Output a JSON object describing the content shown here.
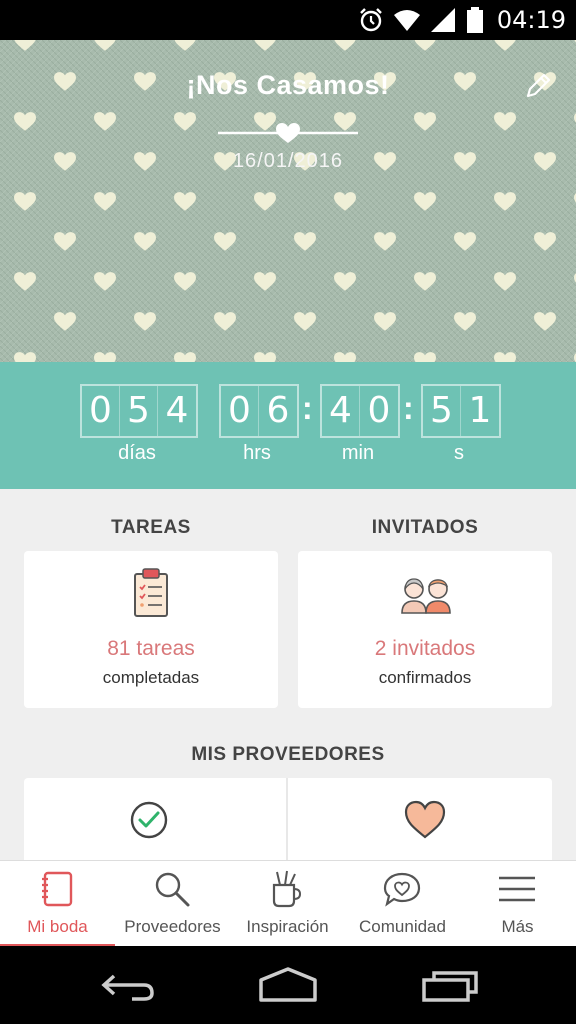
{
  "status_bar": {
    "time": "04:19",
    "icons": [
      "alarm-icon",
      "wifi-icon",
      "signal-icon",
      "battery-icon"
    ]
  },
  "hero": {
    "title": "¡Nos Casamos!",
    "date": "16/01/2016",
    "edit_icon": "pencil-icon"
  },
  "countdown": {
    "days": [
      "0",
      "5",
      "4"
    ],
    "hours": [
      "0",
      "6"
    ],
    "minutes": [
      "4",
      "0"
    ],
    "seconds": [
      "5",
      "1"
    ],
    "labels": {
      "days": "días",
      "hours": "hrs",
      "minutes": "min",
      "seconds": "s"
    }
  },
  "tasks": {
    "section_title": "TAREAS",
    "count_text": "81 tareas",
    "sub_text": "completadas",
    "icon": "clipboard-icon"
  },
  "guests": {
    "section_title": "INVITADOS",
    "count_text": "2 invitados",
    "sub_text": "confirmados",
    "icon": "couple-icon"
  },
  "providers": {
    "section_title": "MIS PROVEEDORES",
    "icons": [
      "check-circle-icon",
      "heart-icon"
    ]
  },
  "bottom_nav": {
    "items": [
      {
        "label": "Mi boda",
        "icon": "notebook-icon",
        "active": true
      },
      {
        "label": "Proveedores",
        "icon": "search-icon",
        "active": false
      },
      {
        "label": "Inspiración",
        "icon": "brush-cup-icon",
        "active": false
      },
      {
        "label": "Comunidad",
        "icon": "chat-heart-icon",
        "active": false
      },
      {
        "label": "Más",
        "icon": "menu-icon",
        "active": false
      }
    ]
  },
  "colors": {
    "teal": "#6ec2b4",
    "accent": "#e0575a",
    "card_text_accent": "#d9787a",
    "hero_bg": "#a9bcae"
  }
}
